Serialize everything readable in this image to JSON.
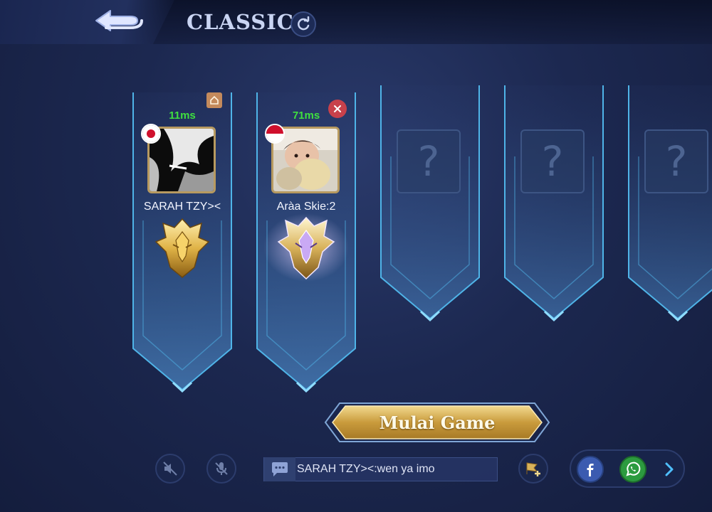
{
  "header": {
    "mode_title": "CLASSIC",
    "back_icon": "back-arrow-icon",
    "refresh_icon": "refresh-icon"
  },
  "slots": [
    {
      "state": "player",
      "ping": "11ms",
      "name": "SARAH TZY><",
      "flag": "japan",
      "badge": "host-icon",
      "rank": "mythic-gold"
    },
    {
      "state": "player",
      "ping": "71ms",
      "name": "Aràa Skie:2",
      "flag": "indonesia",
      "badge": "kick-icon",
      "rank": "mythic-glory"
    },
    {
      "state": "empty",
      "placeholder": "?"
    },
    {
      "state": "empty",
      "placeholder": "?"
    },
    {
      "state": "empty",
      "placeholder": "?"
    }
  ],
  "start_button": {
    "label": "Mulai Game"
  },
  "controls": {
    "speaker_icon": "speaker-muted-icon",
    "mic_icon": "mic-muted-icon",
    "chat_message": "SARAH TZY><:wen ya imo",
    "invite_icon": "invite-flag-icon"
  },
  "share": {
    "facebook_icon": "facebook-icon",
    "whatsapp_icon": "whatsapp-icon",
    "more_icon": "chevron-right-icon"
  },
  "colors": {
    "ping": "#3fe03f",
    "banner_edge": "#4fb4e8",
    "gold": "#d8b25a"
  }
}
